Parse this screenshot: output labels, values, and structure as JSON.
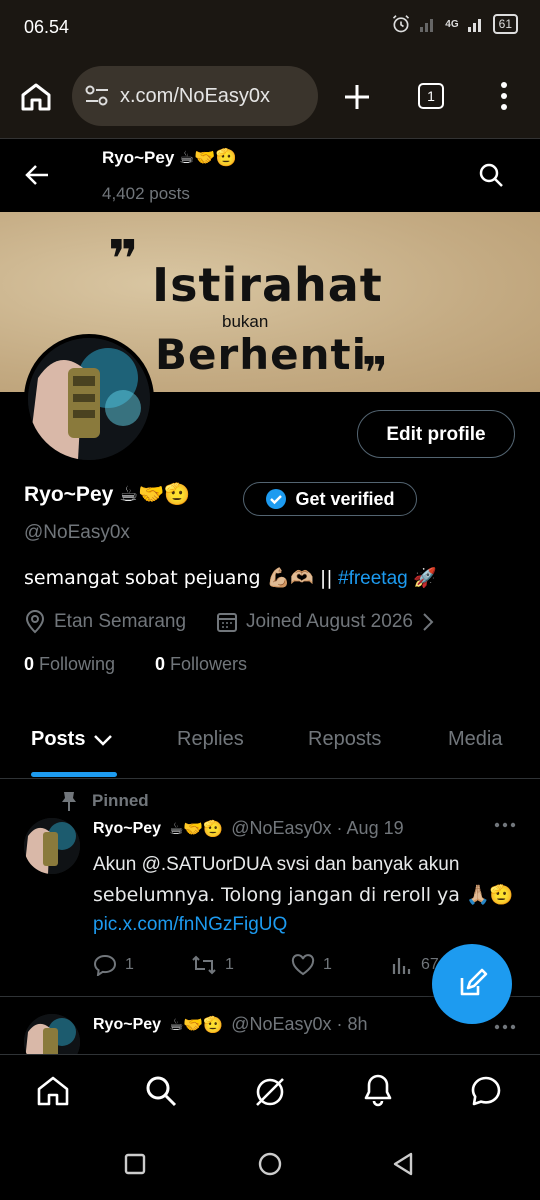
{
  "status_bar": {
    "time": "06.54",
    "network": "4G",
    "battery": "61"
  },
  "browser": {
    "url": "x.com/NoEasy0x",
    "tab_count": "1"
  },
  "header": {
    "name": "Ryo~Pey",
    "emojis": "☕🤝🫡",
    "post_count": "4,402 posts"
  },
  "banner": {
    "line1": "Istirahat",
    "line2": "bukan",
    "line3": "Berhenti"
  },
  "profile": {
    "edit_button": "Edit profile",
    "name": "Ryo~Pey",
    "emojis": "☕🤝🫡",
    "get_verified": "Get verified",
    "handle": "@NoEasy0x",
    "bio_text": "semangat sobat pejuang 💪🏼🫶🏼 ||",
    "bio_hashtag": "#freetag",
    "bio_end": "🚀",
    "location": "Etan Semarang",
    "joined": "Joined August 2026",
    "following_count": "0",
    "following_label": "Following",
    "followers_count": "0",
    "followers_label": "Followers"
  },
  "tabs": [
    {
      "label": "Posts"
    },
    {
      "label": "Replies"
    },
    {
      "label": "Reposts"
    },
    {
      "label": "Media"
    }
  ],
  "posts": [
    {
      "pinned_label": "Pinned",
      "name": "Ryo~Pey",
      "emojis": "☕🤝🫡",
      "handle_time": "@NoEasy0x · Aug 19",
      "text1": "Akun @.SATUorDUA svsi dan banyak akun",
      "text2": "sebelumnya. Tolong jangan di reroll ya 🙏🏼🫡",
      "link": "pic.x.com/fnNGzFigUQ",
      "replies": "1",
      "reposts": "1",
      "likes": "1",
      "views": "67"
    },
    {
      "name": "Ryo~Pey",
      "emojis": "☕🤝🫡",
      "handle_time": "@NoEasy0x · 8h"
    }
  ],
  "colors": {
    "accent": "#1d9bf0",
    "muted": "#71767b",
    "background": "#000000"
  }
}
